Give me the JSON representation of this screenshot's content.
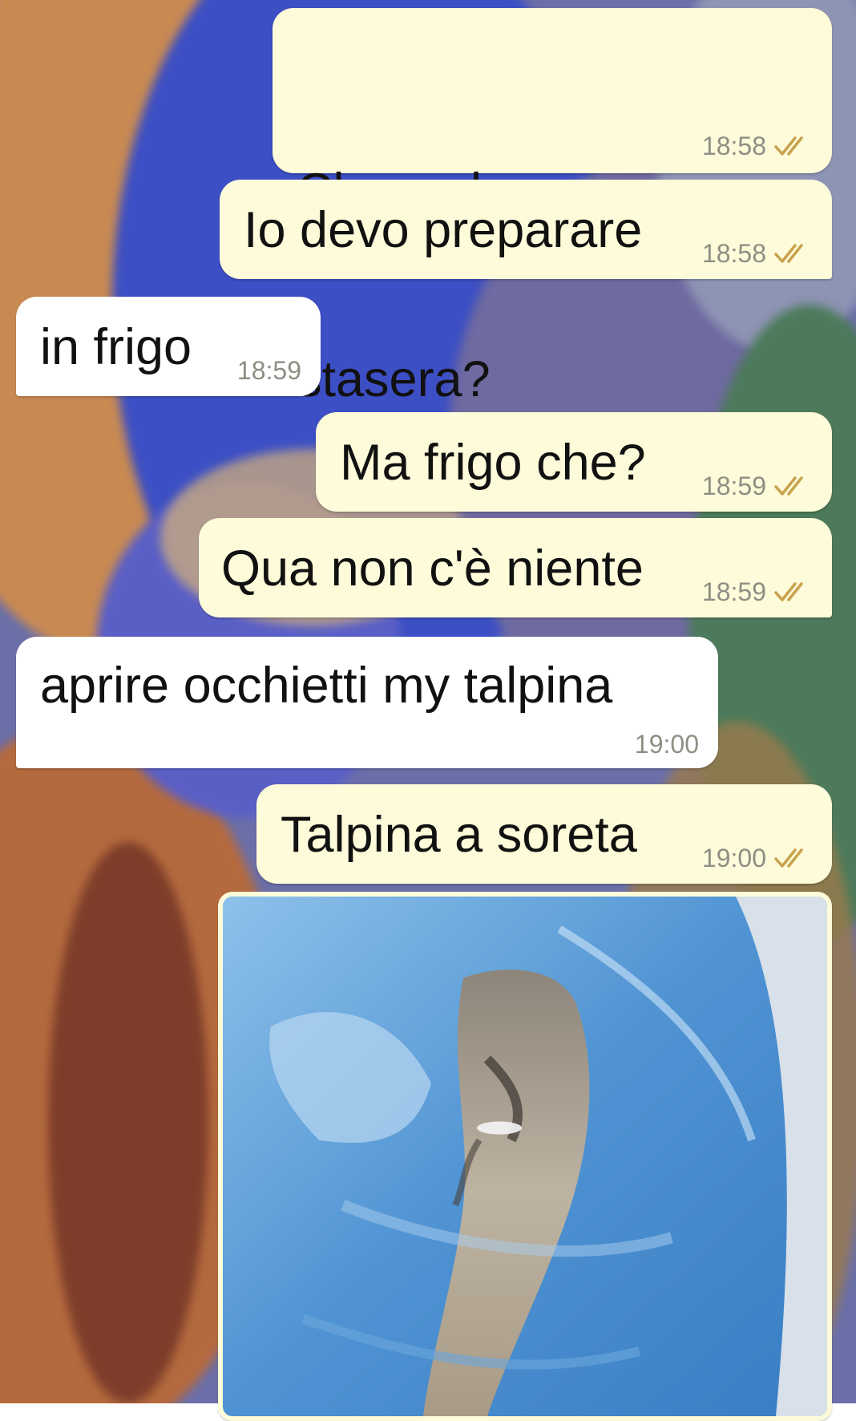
{
  "colors": {
    "outgoing_bubble": "#fdfbd9",
    "incoming_bubble": "#ffffff",
    "read_ticks": "#c9a24e",
    "timestamp": "#8e8e84"
  },
  "messages": [
    {
      "direction": "outgoing",
      "text_lines": [
        "Cla ma la spesa per",
        "stasera?"
      ],
      "time": "18:58",
      "status": "read"
    },
    {
      "direction": "outgoing",
      "text": "Io devo preparare",
      "time": "18:58",
      "status": "read"
    },
    {
      "direction": "incoming",
      "text": "in frigo",
      "time": "18:59"
    },
    {
      "direction": "outgoing",
      "text": "Ma frigo che?",
      "time": "18:59",
      "status": "read"
    },
    {
      "direction": "outgoing",
      "text": "Qua non c'è niente",
      "time": "18:59",
      "status": "read"
    },
    {
      "direction": "incoming",
      "text": "aprire occhietti my talpina",
      "time": "19:00"
    },
    {
      "direction": "outgoing",
      "text": "Talpina a soreta",
      "time": "19:00",
      "status": "read"
    }
  ],
  "media_message": {
    "direction": "outgoing",
    "type": "photo"
  },
  "icons": {
    "read_receipt": "double-check-icon"
  }
}
